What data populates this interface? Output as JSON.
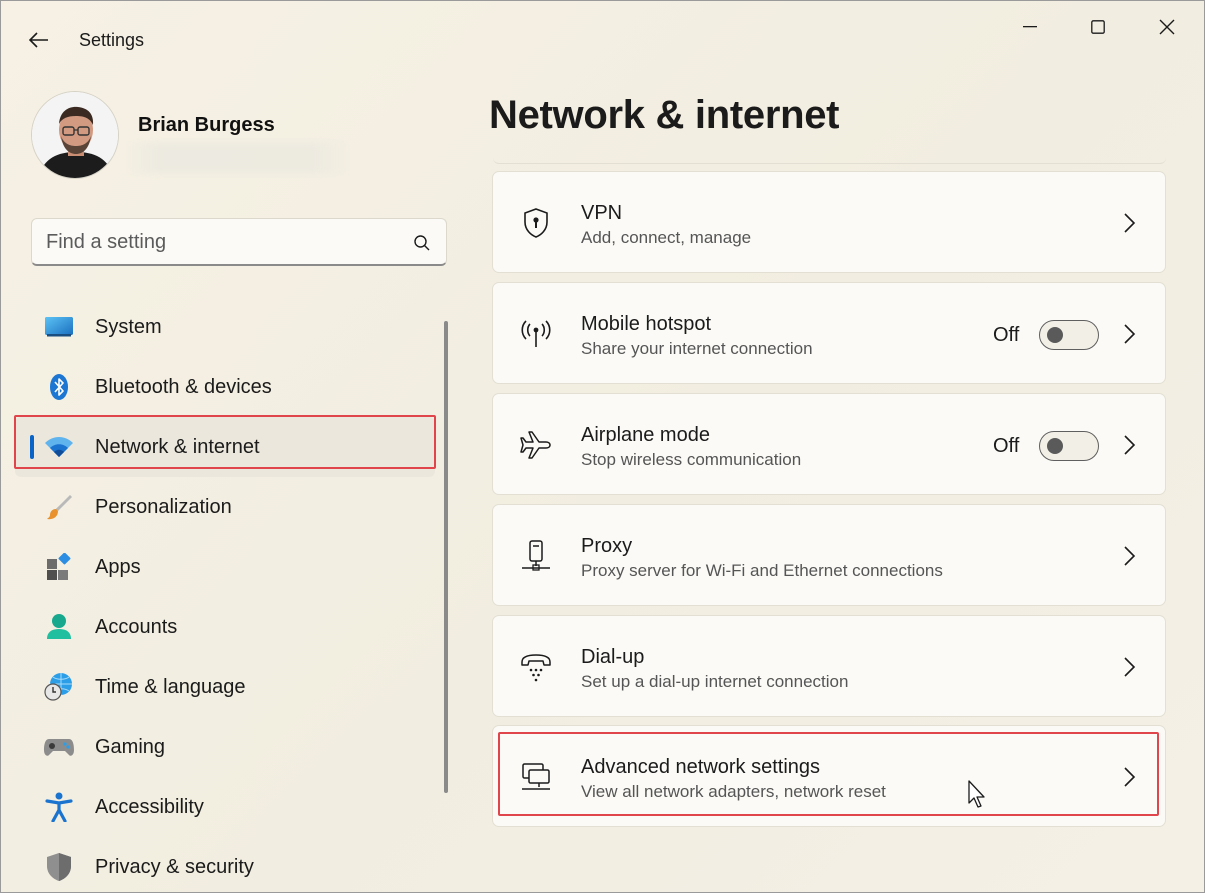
{
  "window": {
    "app_title": "Settings"
  },
  "user": {
    "name": "Brian Burgess"
  },
  "search": {
    "placeholder": "Find a setting"
  },
  "sidebar": {
    "items": [
      {
        "label": "System",
        "icon": "system-icon"
      },
      {
        "label": "Bluetooth & devices",
        "icon": "bluetooth-icon"
      },
      {
        "label": "Network & internet",
        "icon": "wifi-icon",
        "selected": true
      },
      {
        "label": "Personalization",
        "icon": "brush-icon"
      },
      {
        "label": "Apps",
        "icon": "apps-icon"
      },
      {
        "label": "Accounts",
        "icon": "accounts-icon"
      },
      {
        "label": "Time & language",
        "icon": "globe-clock-icon"
      },
      {
        "label": "Gaming",
        "icon": "gamepad-icon"
      },
      {
        "label": "Accessibility",
        "icon": "accessibility-icon"
      },
      {
        "label": "Privacy & security",
        "icon": "shield-icon"
      }
    ]
  },
  "main": {
    "title": "Network & internet",
    "cards": [
      {
        "title": "VPN",
        "subtitle": "Add, connect, manage",
        "icon": "vpn-shield-icon"
      },
      {
        "title": "Mobile hotspot",
        "subtitle": "Share your internet connection",
        "icon": "hotspot-icon",
        "toggle": "Off"
      },
      {
        "title": "Airplane mode",
        "subtitle": "Stop wireless communication",
        "icon": "airplane-icon",
        "toggle": "Off"
      },
      {
        "title": "Proxy",
        "subtitle": "Proxy server for Wi-Fi and Ethernet connections",
        "icon": "proxy-icon"
      },
      {
        "title": "Dial-up",
        "subtitle": "Set up a dial-up internet connection",
        "icon": "dialup-icon"
      },
      {
        "title": "Advanced network settings",
        "subtitle": "View all network adapters, network reset",
        "icon": "network-adapter-icon"
      }
    ]
  },
  "colors": {
    "accent": "#0a64c8",
    "highlight": "#e0454c"
  }
}
